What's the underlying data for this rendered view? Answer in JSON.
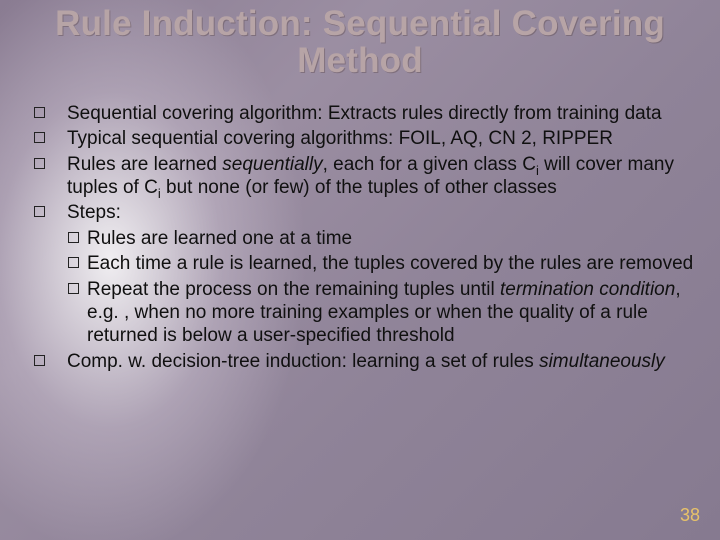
{
  "title_line1": "Rule Induction: Sequential Covering",
  "title_line2": "Method",
  "bullets": {
    "b1": "Sequential covering algorithm: Extracts rules directly from training data",
    "b2": "Typical sequential covering algorithms: FOIL, AQ, CN 2, RIPPER",
    "b3_pre": "Rules are learned ",
    "b3_ital": "sequentially",
    "b3_mid": ", each for a given class C",
    "b3_sub1": "i",
    "b3_mid2": " will cover many tuples of C",
    "b3_sub2": "i",
    "b3_post": " but none (or few) of the tuples of other classes",
    "b4": "Steps:",
    "s1": "Rules are learned one at a time",
    "s2": "Each time a rule is learned, the tuples covered by the rules are removed",
    "s3_pre": "Repeat the process on the remaining tuples until ",
    "s3_ital": "termination condition",
    "s3_post": ", e.g. , when no more training examples or when the quality of a rule returned is below a user-specified threshold",
    "b5_pre": "Comp. w. decision-tree induction: learning a set of rules ",
    "b5_ital": "simultaneously"
  },
  "page_number": "38"
}
